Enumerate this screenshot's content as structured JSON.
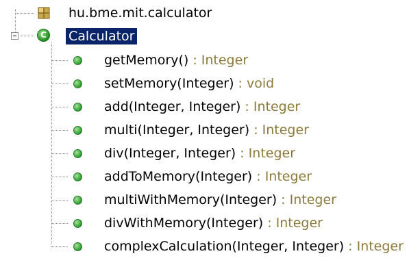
{
  "tree": {
    "package": {
      "label": "hu.bme.mit.calculator",
      "icon": "package-icon"
    },
    "class": {
      "label": "Calculator",
      "icon": "class-icon",
      "icon_letter": "C",
      "expanded": true,
      "selected": true
    },
    "methods": [
      {
        "signature": "getMemory()",
        "return_type": " : Integer"
      },
      {
        "signature": "setMemory(Integer)",
        "return_type": " : void"
      },
      {
        "signature": "add(Integer, Integer)",
        "return_type": " : Integer"
      },
      {
        "signature": "multi(Integer, Integer)",
        "return_type": " : Integer"
      },
      {
        "signature": "div(Integer, Integer)",
        "return_type": " : Integer"
      },
      {
        "signature": "addToMemory(Integer)",
        "return_type": " : Integer"
      },
      {
        "signature": "multiWithMemory(Integer)",
        "return_type": " : Integer"
      },
      {
        "signature": "divWithMemory(Integer)",
        "return_type": " : Integer"
      },
      {
        "signature": "complexCalculation(Integer, Integer)",
        "return_type": " : Integer"
      }
    ]
  },
  "colors": {
    "return_type": "#8c7a3a",
    "selection_bg": "#0a246a",
    "method_icon": "#3fae3f"
  }
}
